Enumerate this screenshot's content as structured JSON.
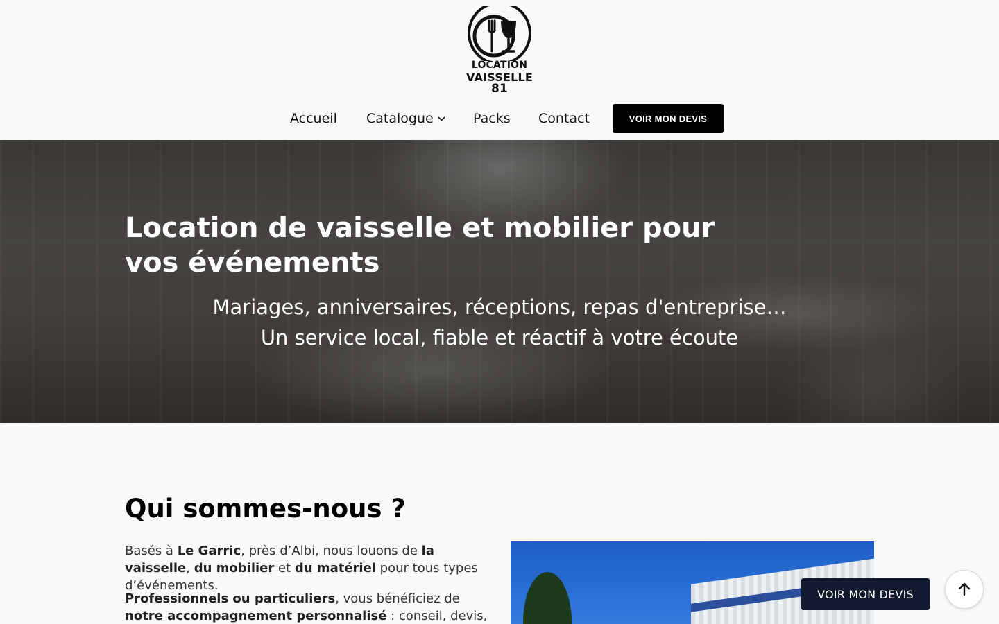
{
  "brand": {
    "logo_line1": "LOCATION",
    "logo_line2": "VAISSELLE",
    "logo_line3": "81"
  },
  "nav": {
    "items": [
      {
        "label": "Accueil"
      },
      {
        "label": "Catalogue",
        "has_dropdown": true
      },
      {
        "label": "Packs"
      },
      {
        "label": "Contact"
      }
    ],
    "cta_label": "VOIR MON DEVIS"
  },
  "hero": {
    "title": "Location de vaisselle et mobilier pour vos événements",
    "subtitle_line1": "Mariages, anniversaires, réceptions, repas d'entreprise…",
    "subtitle_line2": "Un service local, fiable et réactif à votre écoute"
  },
  "about": {
    "title": "Qui sommes-nous ?",
    "p1": {
      "t1": "Basés à ",
      "b1": "Le Garric",
      "t2": ", près d’Albi, nous louons de ",
      "b2": "la vaisselle",
      "t3": ", ",
      "b3": "du mobilier",
      "t4": " et ",
      "b4": "du matériel",
      "t5": " pour tous types d’événements."
    },
    "p2": {
      "b1": "Professionnels ou particuliers",
      "t1": ", vous bénéficiez de ",
      "b2": "notre accompagnement personnalisé",
      "t2": " : conseil, devis, livraison et"
    }
  },
  "floating": {
    "devis_label": "VOIR MON DEVIS",
    "scroll_top_icon": "arrow-up-icon"
  },
  "colors": {
    "cta_bg": "#000000",
    "floating_cta_bg": "#111a2e",
    "page_bg": "#f8f9fb"
  }
}
